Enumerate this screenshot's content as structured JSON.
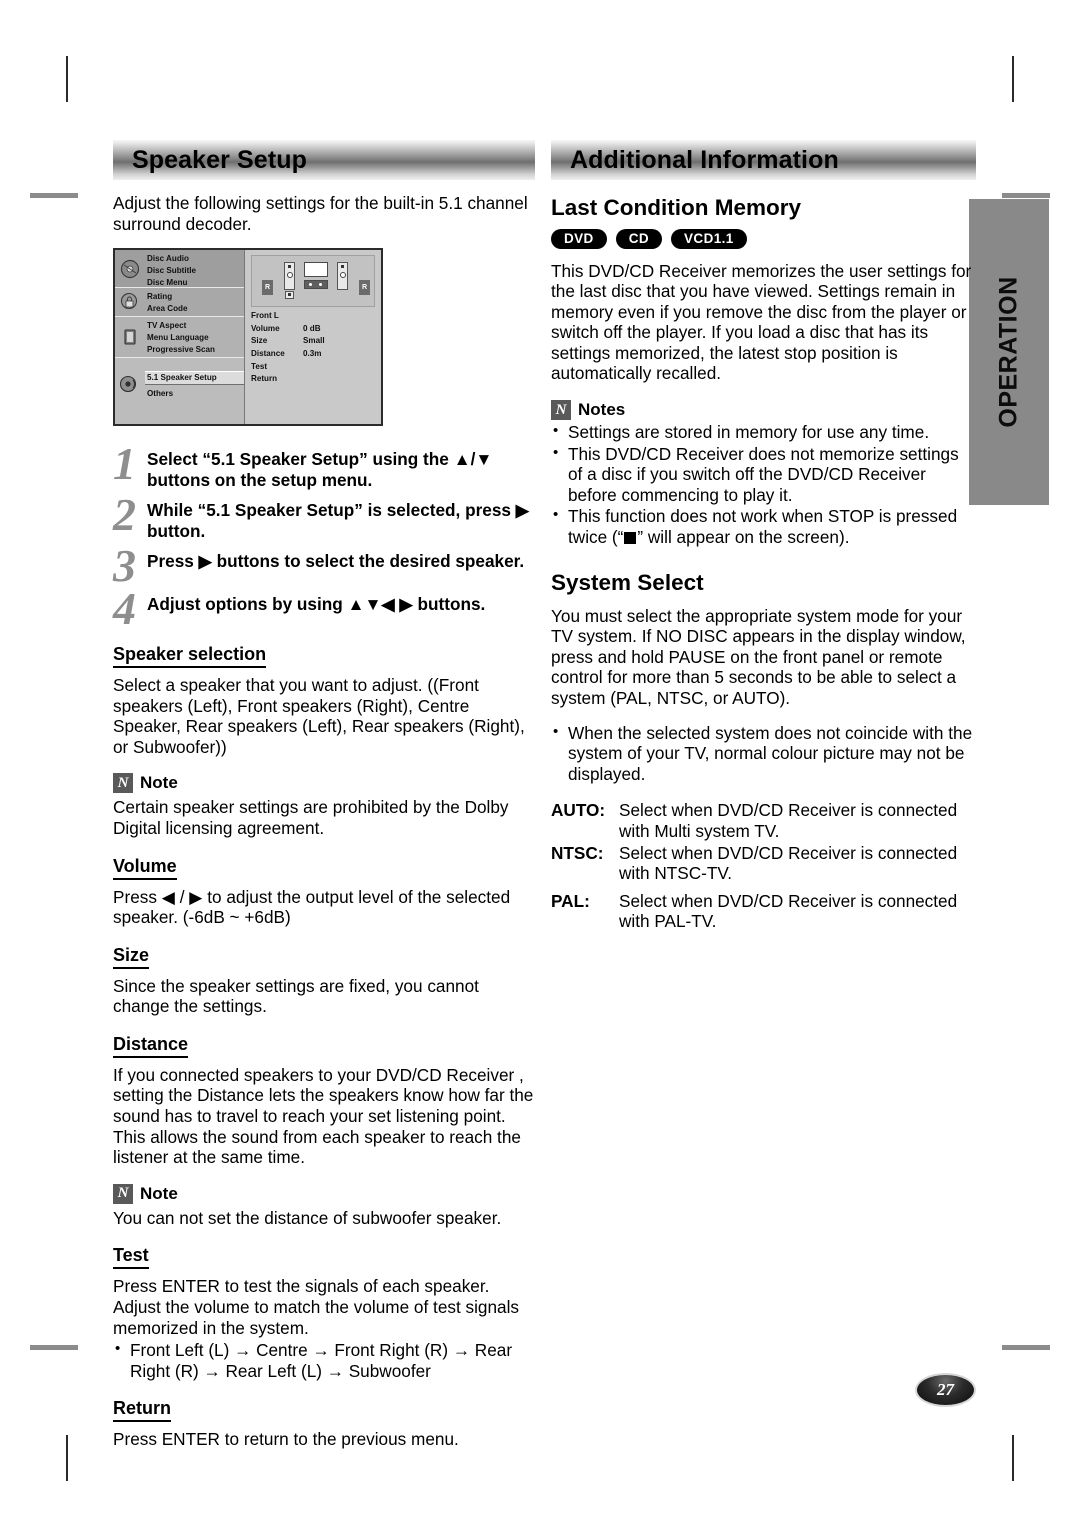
{
  "page": {
    "number": "27",
    "side_tab": "OPERATION"
  },
  "left": {
    "header": "Speaker Setup",
    "intro": "Adjust the following settings for the built-in 5.1 channel surround decoder.",
    "osd": {
      "groups": [
        {
          "icon": "disc-audio-icon",
          "items": [
            "Disc Audio",
            "Disc Subtitle",
            "Disc Menu"
          ]
        },
        {
          "icon": "lock-rating-icon",
          "items": [
            "Rating",
            "Area Code"
          ]
        },
        {
          "icon": "display-icon",
          "items": [
            "TV Aspect",
            "Menu Language",
            "Progressive Scan"
          ]
        },
        {
          "icon": "speaker-icon",
          "items": [
            "5.1 Speaker Setup",
            "Others"
          ]
        }
      ],
      "selected_item": "5.1 Speaker Setup",
      "detail": {
        "speaker_label": "Front L",
        "rows": [
          {
            "key": "Volume",
            "value": "0 dB"
          },
          {
            "key": "Size",
            "value": "Small"
          },
          {
            "key": "Distance",
            "value": "0.3m"
          },
          {
            "key": "Test",
            "value": ""
          },
          {
            "key": "Return",
            "value": ""
          }
        ],
        "diagram_labels": [
          "R",
          "R"
        ]
      }
    },
    "steps": [
      {
        "num": "1",
        "text": "Select “5.1 Speaker Setup” using the ▲/▼ buttons on the setup menu."
      },
      {
        "num": "2",
        "text": "While “5.1 Speaker Setup” is selected, press ▶ button."
      },
      {
        "num": "3",
        "text": "Press ▶ buttons to select the desired speaker."
      },
      {
        "num": "4",
        "text": "Adjust options by using ▲▼◀ ▶ buttons."
      }
    ],
    "speaker_selection": {
      "heading": "Speaker selection",
      "body": "Select a speaker that you want to adjust. ((Front speakers (Left), Front speakers (Right), Centre Speaker, Rear speakers (Left), Rear  speakers (Right), or Subwoofer))",
      "note_label": "Note",
      "note_icon": "N",
      "note_body": "Certain speaker settings are prohibited by the Dolby Digital licensing agreement."
    },
    "volume": {
      "heading": "Volume",
      "body": "Press ◀ / ▶ to adjust the output level of the selected speaker. (-6dB ~ +6dB)"
    },
    "size": {
      "heading": "Size",
      "body": "Since the speaker settings are fixed, you cannot change the settings."
    },
    "distance": {
      "heading": "Distance",
      "body": "If you connected speakers to your DVD/CD Receiver , setting the Distance lets the speakers know how far the sound has to travel to reach your set listening point. This allows the sound from each speaker to reach the listener at the same time.",
      "note_label": "Note",
      "note_icon": "N",
      "note_body": "You can not set the distance of subwoofer speaker."
    },
    "test": {
      "heading": "Test",
      "body": "Press ENTER to test the signals of each speaker. Adjust the volume to match the volume of test signals memorized in the system.",
      "bullets": [
        "Front Left (L) → Centre → Front Right (R) → Rear Right (R) → Rear Left (L)  → Subwoofer"
      ]
    },
    "return": {
      "heading": "Return",
      "body": "Press ENTER to return to the previous menu."
    }
  },
  "right": {
    "header": "Additional Information",
    "last_condition_memory": {
      "heading": "Last Condition Memory",
      "badges": [
        "DVD",
        "CD",
        "VCD1.1"
      ],
      "body": "This DVD/CD Receiver  memorizes the user settings for the last disc that you have viewed. Settings remain in memory even if you remove the disc from the player or switch off the player. If you load a disc that has its settings memorized, the latest stop position is automatically recalled.",
      "notes_label": "Notes",
      "notes_icon": "N",
      "notes": [
        "Settings are stored in memory for use any time.",
        "This DVD/CD Receiver does not memorize settings of a disc if you switch off the DVD/CD Receiver  before commencing to play it.",
        "This function does not work when STOP is pressed twice (“■” will appear on the screen)."
      ]
    },
    "system_select": {
      "heading": "System Select",
      "body": "You must select the appropriate system mode for your TV system. If NO DISC appears in the display window, press and hold PAUSE on the front panel or remote control for more than 5 seconds to be able to select a system (PAL, NTSC, or AUTO).",
      "bullets": [
        "When the selected system does not coincide with the system of your TV, normal colour picture may not be displayed."
      ],
      "definitions": [
        {
          "term": "AUTO:",
          "desc": "Select when DVD/CD Receiver is connected with Multi system TV."
        },
        {
          "term": "NTSC:",
          "desc": "Select when DVD/CD Receiver is connected with NTSC-TV."
        },
        {
          "term": "PAL:",
          "desc": "Select when DVD/CD Receiver is connected with PAL-TV."
        }
      ]
    }
  }
}
